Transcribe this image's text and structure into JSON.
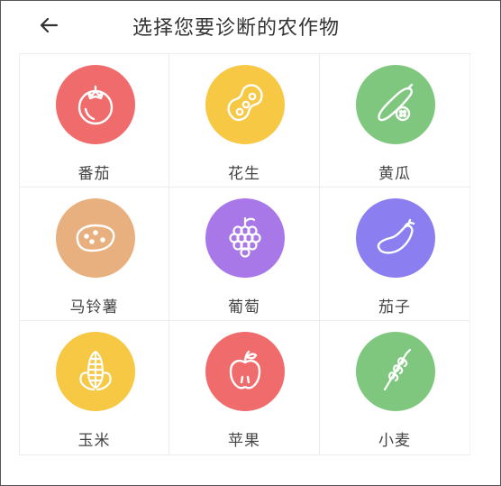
{
  "header": {
    "title": "选择您要诊断的农作物"
  },
  "crops": [
    {
      "label": "番茄",
      "icon": "tomato-icon",
      "color": "#f06b6b"
    },
    {
      "label": "花生",
      "icon": "peanut-icon",
      "color": "#f7c843"
    },
    {
      "label": "黄瓜",
      "icon": "cucumber-icon",
      "color": "#7fc77e"
    },
    {
      "label": "马铃薯",
      "icon": "potato-icon",
      "color": "#e9b07f"
    },
    {
      "label": "葡萄",
      "icon": "grape-icon",
      "color": "#a877e8"
    },
    {
      "label": "茄子",
      "icon": "eggplant-icon",
      "color": "#8a7ef0"
    },
    {
      "label": "玉米",
      "icon": "corn-icon",
      "color": "#f7c843"
    },
    {
      "label": "苹果",
      "icon": "apple-icon",
      "color": "#f06b6b"
    },
    {
      "label": "小麦",
      "icon": "wheat-icon",
      "color": "#7fc77e"
    }
  ]
}
